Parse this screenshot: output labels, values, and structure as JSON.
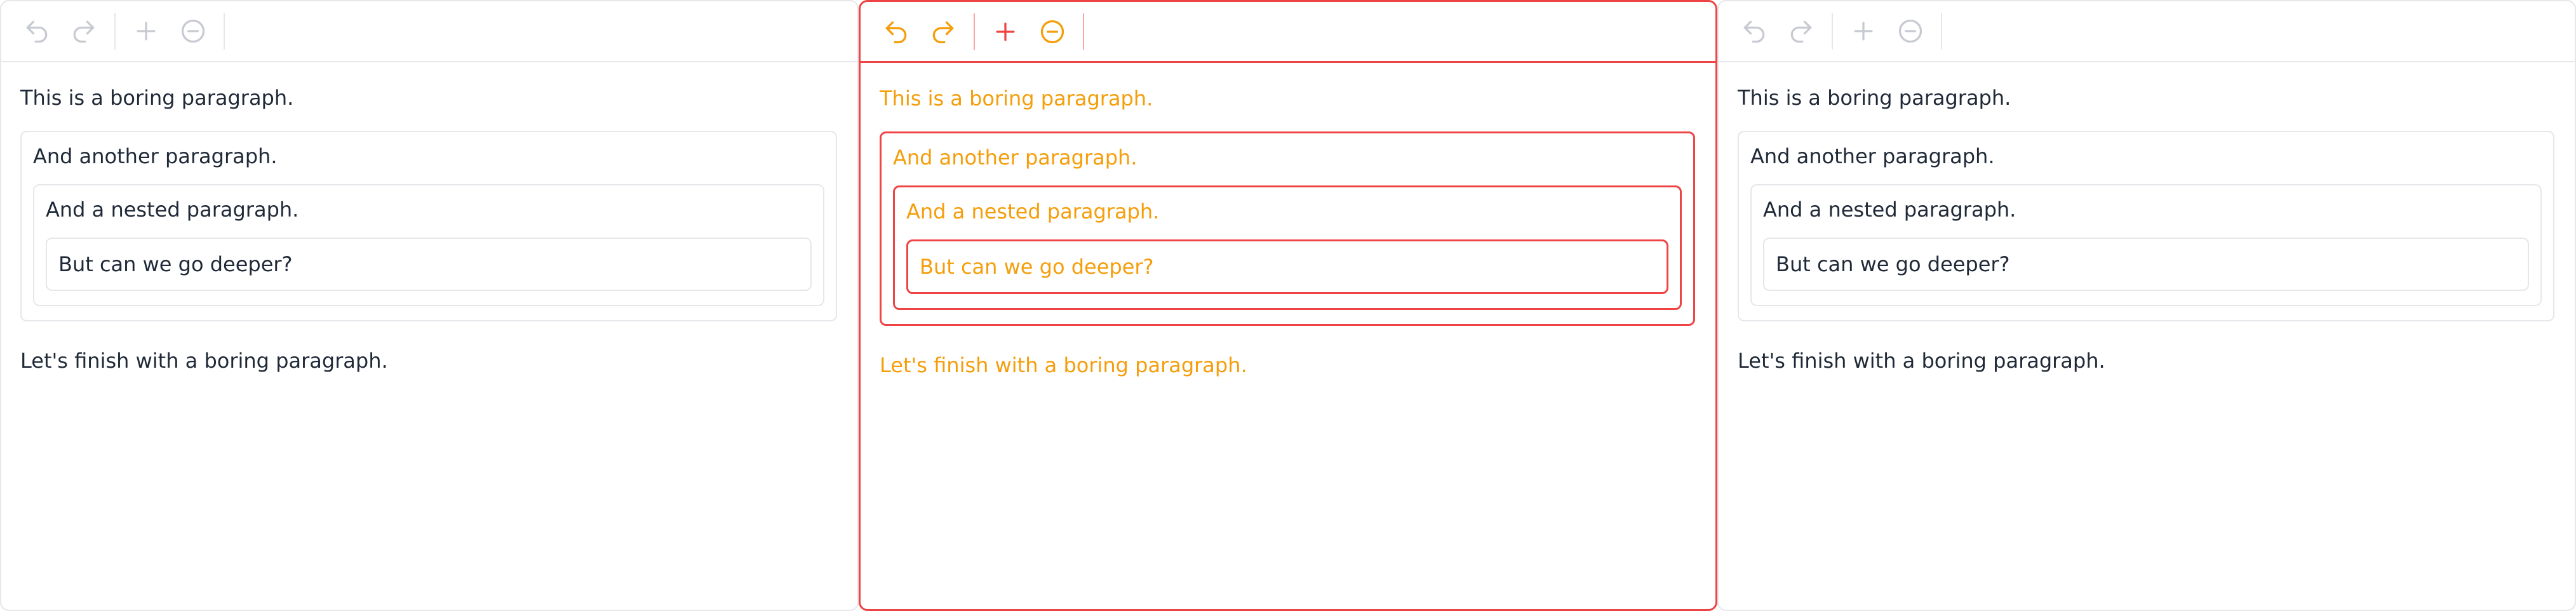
{
  "panels": [
    {
      "variant": "before",
      "toolbar": {
        "undo_icon": "undo-icon",
        "redo_icon": "redo-icon",
        "add_icon": "plus-icon",
        "remove_icon": "minus-circle-icon"
      },
      "content": {
        "p1": "This is a boring paragraph.",
        "p2": "And another paragraph.",
        "p3": "And a nested paragraph.",
        "p4": "But can we go deeper?",
        "p5": "Let's finish with a boring paragraph."
      }
    },
    {
      "variant": "diff",
      "toolbar": {
        "undo_icon": "undo-icon",
        "redo_icon": "redo-icon",
        "add_icon": "plus-icon",
        "remove_icon": "minus-circle-icon"
      },
      "content": {
        "p1": "This is a boring paragraph.",
        "p2": "And another paragraph.",
        "p3": "And a nested paragraph.",
        "p4": "But can we go deeper?",
        "p5": "Let's finish with a boring paragraph."
      }
    },
    {
      "variant": "after",
      "toolbar": {
        "undo_icon": "undo-icon",
        "redo_icon": "redo-icon",
        "add_icon": "plus-icon",
        "remove_icon": "minus-circle-icon"
      },
      "content": {
        "p1": "This is a boring paragraph.",
        "p2": "And another paragraph.",
        "p3": "And a nested paragraph.",
        "p4": "But can we go deeper?",
        "p5": "Let's finish with a boring paragraph."
      }
    }
  ],
  "colors": {
    "text": "#1f2937",
    "border": "#e5e7eb",
    "icon_muted": "#c7cbd1",
    "diff_red": "#ef4444",
    "diff_orange": "#f59e0b"
  }
}
